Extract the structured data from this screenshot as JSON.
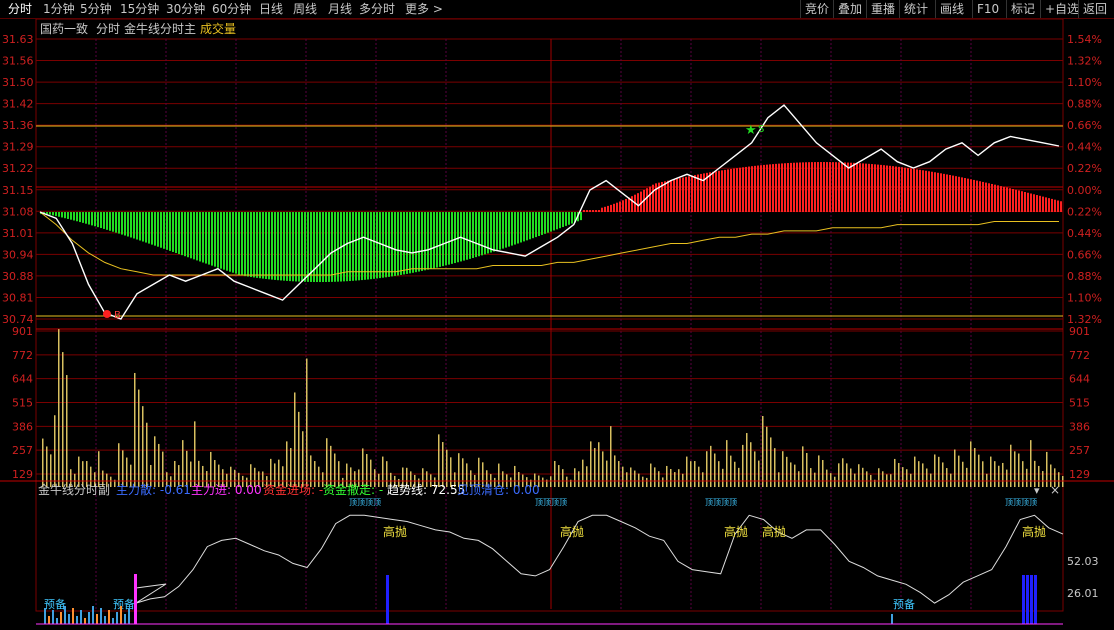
{
  "tabs": [
    {
      "label": "分时",
      "active": true
    },
    {
      "label": "1分钟"
    },
    {
      "label": "5分钟"
    },
    {
      "label": "15分钟"
    },
    {
      "label": "30分钟"
    },
    {
      "label": "60分钟"
    },
    {
      "label": "日线"
    },
    {
      "label": "周线"
    },
    {
      "label": "月线"
    },
    {
      "label": "多分时"
    },
    {
      "label": "更多 >"
    }
  ],
  "toolbar": [
    "竞价",
    "叠加",
    "重播",
    "统计",
    "画线",
    "F10",
    "标记",
    "+自选",
    "返回"
  ],
  "main_header": {
    "stock": "国药一致",
    "view": "分时",
    "indicator": "金牛线分时主",
    "volume": "成交量"
  },
  "sub_header": {
    "name": "金牛线分时副",
    "items": [
      {
        "label": "主力散: -0.61",
        "color": "#3b6cff"
      },
      {
        "label": "主力进: 0.00",
        "color": "#ff33ff"
      },
      {
        "label": "资金进场: -",
        "color": "#ff3333"
      },
      {
        "label": "资金撤走: -",
        "color": "#33ff33"
      },
      {
        "label": "趋势线: 72.55",
        "color": "#ffffff"
      },
      {
        "label": "见顶清仓: 0.00",
        "color": "#3b6cff"
      }
    ]
  },
  "price_axis": {
    "left": [
      "31.63",
      "31.56",
      "31.50",
      "31.42",
      "31.36",
      "31.29",
      "31.22",
      "31.15",
      "31.08",
      "31.01",
      "30.94",
      "30.88",
      "30.81",
      "30.74"
    ],
    "right": [
      "1.54%",
      "1.32%",
      "1.10%",
      "0.88%",
      "0.66%",
      "0.44%",
      "0.22%",
      "0.00%",
      "0.22%",
      "0.44%",
      "0.66%",
      "0.88%",
      "1.10%",
      "1.32%"
    ]
  },
  "volume_axis": [
    "901",
    "772",
    "644",
    "515",
    "386",
    "257",
    "129"
  ],
  "sub_axis": [
    "52.03",
    "26.01"
  ],
  "markers": {
    "buy": "B",
    "sell": "S",
    "high_sell": "高抛",
    "prepare": "预备",
    "top": "顶顶顶顶",
    "alerts": [
      "高抛",
      "高抛",
      "高抛",
      "高抛",
      "高抛"
    ],
    "prepares": [
      "预备",
      "预备",
      "预备"
    ]
  },
  "colors": {
    "up": "#ff2020",
    "down": "#22dd22",
    "price_line": "#ffffff",
    "avg_line": "#e8c020",
    "grid": "#7a0000",
    "volume": "#d8c060"
  },
  "chart_data": {
    "type": "line",
    "prev_close": 31.15,
    "price_range": [
      30.74,
      31.63
    ],
    "price": [
      31.08,
      31.06,
      30.98,
      30.85,
      30.76,
      30.74,
      30.82,
      30.85,
      30.88,
      30.86,
      30.88,
      30.9,
      30.86,
      30.84,
      30.82,
      30.8,
      30.85,
      30.9,
      30.95,
      30.98,
      31.0,
      30.98,
      30.96,
      30.95,
      30.96,
      30.98,
      31.0,
      30.98,
      30.96,
      30.95,
      30.94,
      30.97,
      31.0,
      31.04,
      31.15,
      31.18,
      31.14,
      31.1,
      31.15,
      31.18,
      31.2,
      31.18,
      31.22,
      31.26,
      31.3,
      31.38,
      31.42,
      31.36,
      31.3,
      31.26,
      31.22,
      31.25,
      31.28,
      31.24,
      31.22,
      31.24,
      31.28,
      31.3,
      31.26,
      31.3,
      31.32,
      31.31,
      31.3,
      31.29
    ],
    "avg": [
      31.08,
      31.04,
      30.99,
      30.95,
      30.92,
      30.9,
      30.89,
      30.88,
      30.88,
      30.88,
      30.88,
      30.88,
      30.88,
      30.88,
      30.88,
      30.88,
      30.88,
      30.88,
      30.88,
      30.89,
      30.89,
      30.89,
      30.89,
      30.9,
      30.9,
      30.9,
      30.9,
      30.9,
      30.91,
      30.91,
      30.91,
      30.91,
      30.92,
      30.92,
      30.93,
      30.94,
      30.95,
      30.96,
      30.97,
      30.98,
      30.98,
      30.99,
      31.0,
      31.0,
      31.01,
      31.01,
      31.02,
      31.02,
      31.02,
      31.03,
      31.03,
      31.03,
      31.03,
      31.04,
      31.04,
      31.04,
      31.04,
      31.04,
      31.04,
      31.05,
      31.05,
      31.05,
      31.05,
      31.05
    ],
    "volume": [
      310,
      900,
      180,
      220,
      120,
      280,
      650,
      300,
      160,
      420,
      200,
      180,
      120,
      140,
      180,
      260,
      760,
      220,
      300,
      150,
      220,
      180,
      120,
      140,
      120,
      300,
      200,
      180,
      150,
      120,
      100,
      80,
      160,
      120,
      260,
      360,
      220,
      120,
      150,
      120,
      180,
      220,
      300,
      240,
      360,
      420,
      220,
      260,
      180,
      140,
      200,
      140,
      120,
      160,
      180,
      200,
      220,
      240,
      260,
      180,
      260,
      300,
      200,
      150
    ]
  }
}
